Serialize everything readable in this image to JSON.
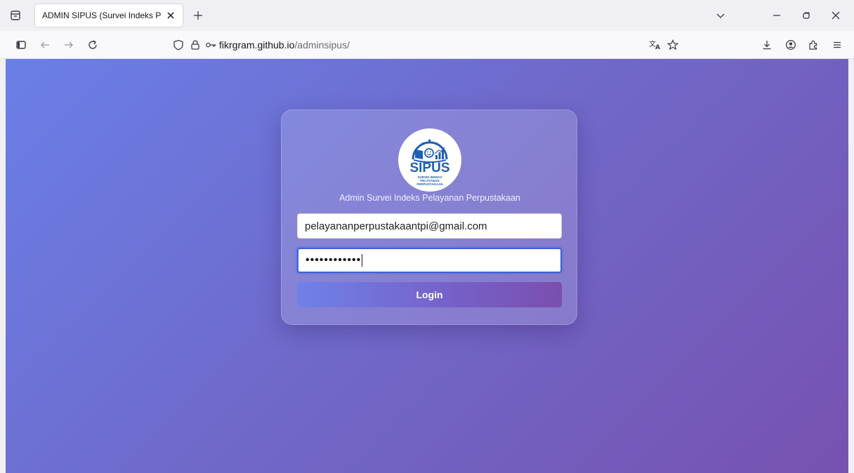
{
  "browser": {
    "tab_title": "ADMIN SIPUS (Survei Indeks Pelayanan Perpustakaan)",
    "url_domain": "fikrgram.github.io",
    "url_path": "/adminsipus/"
  },
  "icons": {
    "tab_list": "tab-list-icon",
    "close": "close-icon",
    "new_tab": "plus-icon",
    "sidebar": "sidebar-icon",
    "back": "back-arrow-icon",
    "forward": "forward-arrow-icon",
    "reload": "reload-icon",
    "tracking_protection": "shield-icon",
    "site_security": "lock-icon",
    "permissions": "key-icon",
    "translate": "translate-icon",
    "bookmark": "star-icon",
    "downloads": "download-icon",
    "account": "account-icon",
    "extensions": "extensions-icon",
    "menu": "hamburger-menu-icon"
  },
  "login": {
    "logo_text": "SIPUS",
    "logo_tagline_1": "SURVEI INDEKS",
    "logo_tagline_2": "PELAYANAN",
    "logo_tagline_3": "PERPUSTAKAAN",
    "subtitle": "Admin Survei Indeks Pelayanan Perpustakaan",
    "email_value": "pelayananperpustakaantpi@gmail.com",
    "password_value": "••••••••••••",
    "login_label": "Login"
  },
  "colors": {
    "gradient_start": "#6a7fe8",
    "gradient_end": "#7752b0",
    "focus_ring": "#3a63d8",
    "logo_blue": "#1f5fb4"
  }
}
